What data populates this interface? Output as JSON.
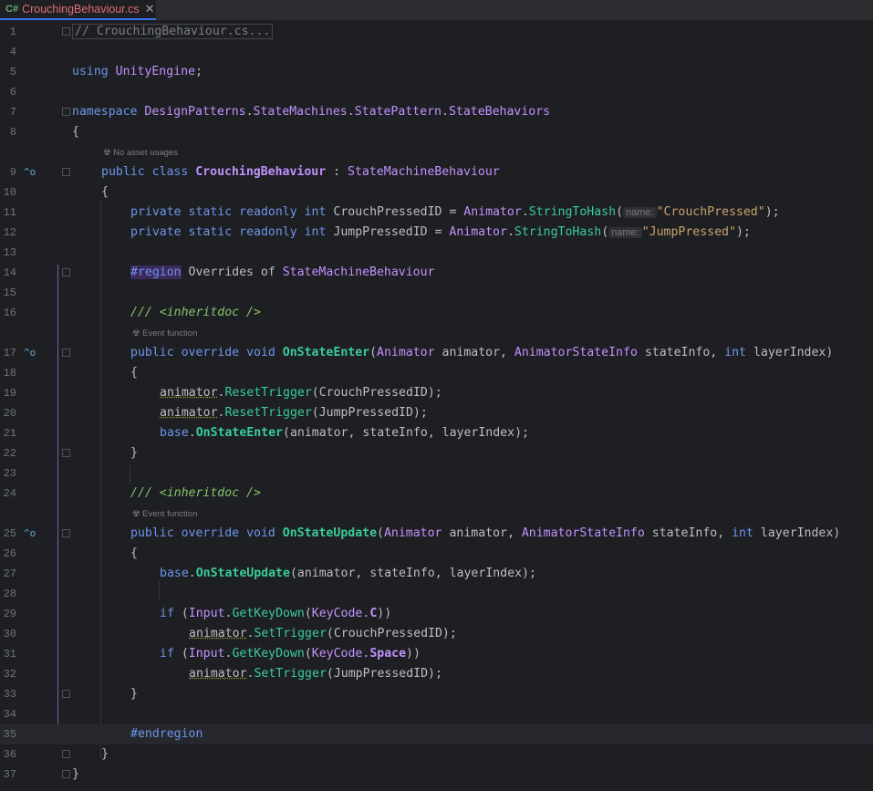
{
  "tab": {
    "lang": "C#",
    "filename": "CrouchingBehaviour.cs",
    "close": "✕"
  },
  "hints": {
    "no_asset_usages": "No asset usages",
    "event_function": "Event function",
    "param_name": "name:"
  },
  "lines": [
    {
      "n": "1",
      "t": "// CrouchingBehaviour.cs..."
    },
    {
      "n": "4",
      "t": ""
    },
    {
      "n": "5",
      "t": "using UnityEngine;"
    },
    {
      "n": "6",
      "t": ""
    },
    {
      "n": "7",
      "t": "namespace DesignPatterns.StateMachines.StatePattern.StateBehaviors"
    },
    {
      "n": "8",
      "t": "{"
    },
    {
      "n": "9",
      "t": "public class CrouchingBehaviour : StateMachineBehaviour"
    },
    {
      "n": "10",
      "t": "{"
    },
    {
      "n": "11",
      "t": "private static readonly int CrouchPressedID = Animator.StringToHash(\"CrouchPressed\");"
    },
    {
      "n": "12",
      "t": "private static readonly int JumpPressedID = Animator.StringToHash(\"JumpPressed\");"
    },
    {
      "n": "13",
      "t": ""
    },
    {
      "n": "14",
      "t": "#region Overrides of StateMachineBehaviour"
    },
    {
      "n": "15",
      "t": ""
    },
    {
      "n": "16",
      "t": "/// <inheritdoc />"
    },
    {
      "n": "17",
      "t": "public override void OnStateEnter(Animator animator, AnimatorStateInfo stateInfo, int layerIndex)"
    },
    {
      "n": "18",
      "t": "{"
    },
    {
      "n": "19",
      "t": "animator.ResetTrigger(CrouchPressedID);"
    },
    {
      "n": "20",
      "t": "animator.ResetTrigger(JumpPressedID);"
    },
    {
      "n": "21",
      "t": "base.OnStateEnter(animator, stateInfo, layerIndex);"
    },
    {
      "n": "22",
      "t": "}"
    },
    {
      "n": "23",
      "t": ""
    },
    {
      "n": "24",
      "t": "/// <inheritdoc />"
    },
    {
      "n": "25",
      "t": "public override void OnStateUpdate(Animator animator, AnimatorStateInfo stateInfo, int layerIndex)"
    },
    {
      "n": "26",
      "t": "{"
    },
    {
      "n": "27",
      "t": "base.OnStateUpdate(animator, stateInfo, layerIndex);"
    },
    {
      "n": "28",
      "t": ""
    },
    {
      "n": "29",
      "t": "if (Input.GetKeyDown(KeyCode.C))"
    },
    {
      "n": "30",
      "t": "animator.SetTrigger(CrouchPressedID);"
    },
    {
      "n": "31",
      "t": "if (Input.GetKeyDown(KeyCode.Space))"
    },
    {
      "n": "32",
      "t": "animator.SetTrigger(JumpPressedID);"
    },
    {
      "n": "33",
      "t": "}"
    },
    {
      "n": "34",
      "t": ""
    },
    {
      "n": "35",
      "t": "#endregion"
    },
    {
      "n": "36",
      "t": "}"
    },
    {
      "n": "37",
      "t": "}"
    }
  ],
  "colors": {
    "background": "#1e1f22",
    "keyword": "#6c95eb",
    "type": "#c191ff",
    "method": "#39cc9b",
    "string": "#c9a26d",
    "comment": "#85c46c",
    "line_number": "#6f737a",
    "tab_underline": "#3574f0"
  },
  "icons": [
    "csharp-file-icon",
    "close-icon",
    "fold-icon",
    "implemented-up-arrow-icon",
    "unity-event-icon"
  ]
}
